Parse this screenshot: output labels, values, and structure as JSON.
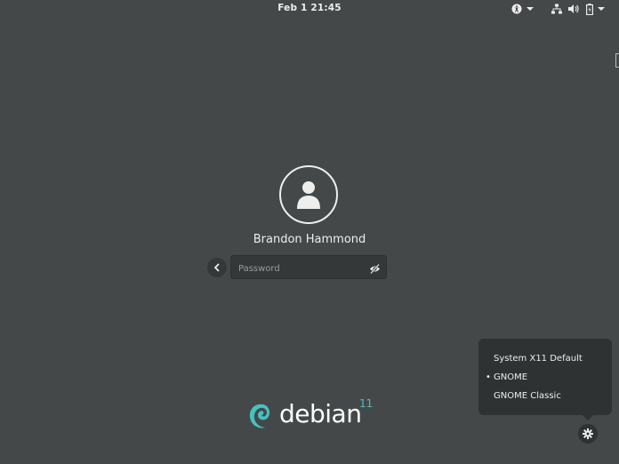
{
  "topbar": {
    "clock": "Feb 1  21:45",
    "icons": [
      "accessibility-icon",
      "dropdown-arrow-icon",
      "network-icon",
      "volume-icon",
      "battery-icon",
      "dropdown-arrow-icon"
    ]
  },
  "login": {
    "avatar_icon": "user-avatar-icon",
    "username": "Brandon Hammond",
    "password_placeholder": "Password",
    "back_icon": "chevron-left-icon",
    "reveal_icon": "eye-hidden-icon"
  },
  "branding": {
    "logo_text": "debian",
    "version": "11"
  },
  "session_menu": {
    "items": [
      {
        "label": "System X11 Default",
        "selected": false
      },
      {
        "label": "GNOME",
        "selected": true
      },
      {
        "label": "GNOME Classic",
        "selected": false
      }
    ],
    "selected_marker": "•",
    "settings_icon": "gear-icon"
  },
  "colors": {
    "background": "#444849",
    "menu_bg": "#2f3233",
    "debian_accent": "#49c0c0",
    "text": "#eeeeec"
  }
}
